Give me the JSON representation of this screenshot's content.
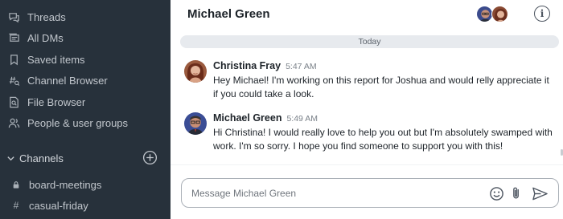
{
  "sidebar": {
    "nav_items": [
      {
        "label": "Threads",
        "icon": "threads-icon"
      },
      {
        "label": "All DMs",
        "icon": "dms-icon"
      },
      {
        "label": "Saved items",
        "icon": "bookmark-icon"
      },
      {
        "label": "Channel Browser",
        "icon": "channel-browser-icon"
      },
      {
        "label": "File Browser",
        "icon": "file-search-icon"
      },
      {
        "label": "People & user groups",
        "icon": "people-icon"
      }
    ],
    "channels_title": "Channels",
    "channels": [
      {
        "label": "board-meetings",
        "icon": "lock-icon"
      },
      {
        "label": "casual-friday",
        "icon": "hash-icon"
      }
    ],
    "colors": {
      "background": "#27313b",
      "text": "#c2c7cd"
    }
  },
  "header": {
    "title": "Michael Green",
    "info_icon": "info-icon"
  },
  "chat": {
    "date_divider": "Today",
    "messages": [
      {
        "author": "Christina Fray",
        "time": "5:47 AM",
        "text": "Hey Michael! I'm working on this report for Joshua and would relly appreciate it if you could take a look."
      },
      {
        "author": "Michael Green",
        "time": "5:49 AM",
        "text": "Hi Christina! I would really love to help you out but I'm absolutely swamped with work. I'm so sorry. I hope you find someone to support you with this!"
      }
    ]
  },
  "composer": {
    "placeholder": "Message Michael Green",
    "value": "",
    "icons": [
      "emoji-icon",
      "attachment-icon",
      "send-icon"
    ]
  }
}
